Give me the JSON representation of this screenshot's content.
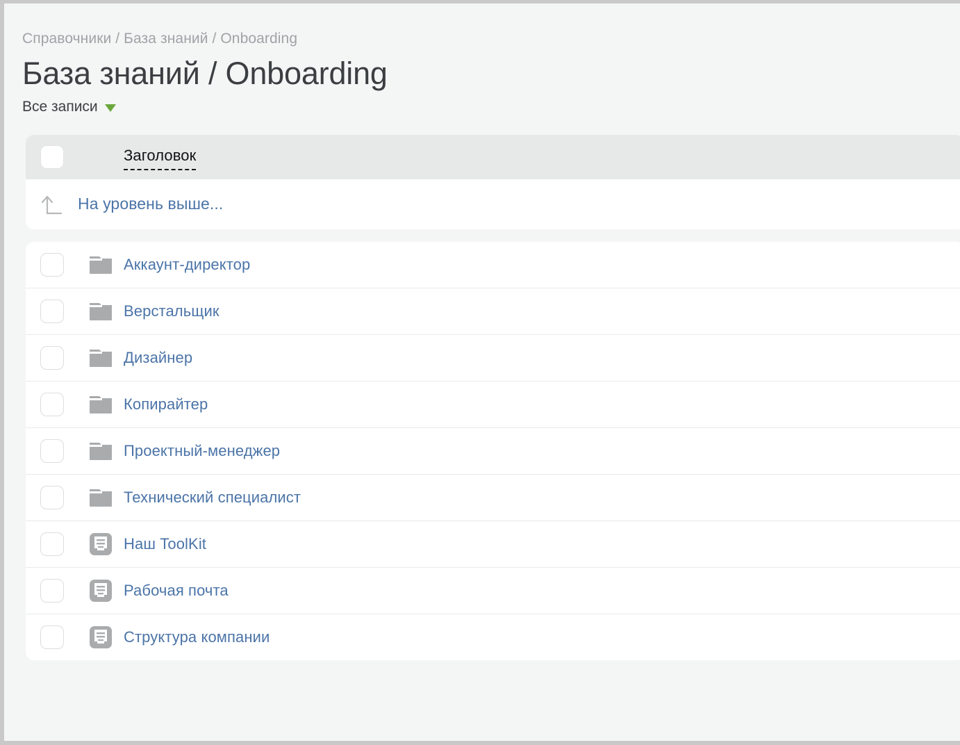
{
  "breadcrumb": {
    "text": "Справочники / База знаний / Onboarding",
    "parts": [
      "Справочники",
      "База знаний",
      "Onboarding"
    ]
  },
  "page_title": "База знаний / Onboarding",
  "filter": {
    "label": "Все записи",
    "caret_icon": "caret-down-icon",
    "caret_color": "#6aa73b"
  },
  "table": {
    "columns": [
      {
        "key": "select",
        "label": ""
      },
      {
        "key": "icon",
        "label": ""
      },
      {
        "key": "title",
        "label": "Заголовок",
        "sortable": true
      }
    ],
    "select_all_checked": false,
    "uplevel_row": {
      "label": "На уровень выше...",
      "icon": "arrow-up-level-icon"
    },
    "rows": [
      {
        "icon": "folder-icon",
        "title": "Аккаунт-директор",
        "checked": false
      },
      {
        "icon": "folder-icon",
        "title": "Верстальщик",
        "checked": false
      },
      {
        "icon": "folder-icon",
        "title": "Дизайнер",
        "checked": false
      },
      {
        "icon": "folder-icon",
        "title": "Копирайтер",
        "checked": false
      },
      {
        "icon": "folder-icon",
        "title": "Проектный-менеджер",
        "checked": false
      },
      {
        "icon": "folder-icon",
        "title": "Технический специалист",
        "checked": false
      },
      {
        "icon": "document-icon",
        "title": "Наш ToolKit",
        "checked": false
      },
      {
        "icon": "document-icon",
        "title": "Рабочая почта",
        "checked": false
      },
      {
        "icon": "document-icon",
        "title": "Структура компании",
        "checked": false
      }
    ]
  },
  "colors": {
    "page_background": "#f4f5f5",
    "row_background": "#ffffff",
    "header_row_background": "#e7e8e8",
    "link_text": "#4b74a8",
    "title_text": "#3b3f42",
    "breadcrumb_text": "#a0a3a6",
    "icon_gray": "#a9abad",
    "accent_green": "#6aa73b",
    "divider": "#e9eaeb"
  }
}
